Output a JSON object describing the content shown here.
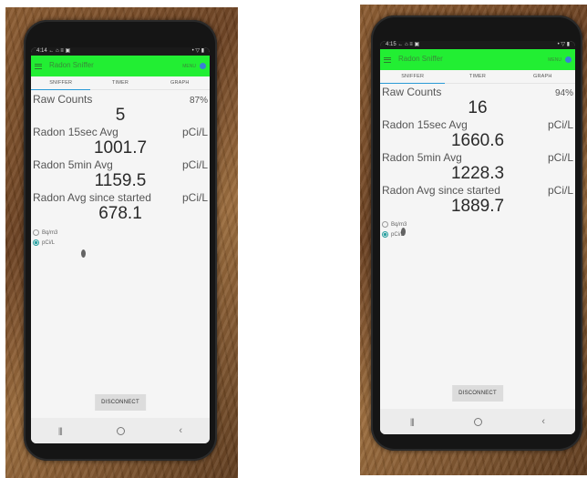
{
  "screenshots": [
    {
      "status_left": "4:14 ← ⌂ ≡ ▣",
      "status_right": "• ▽ ▮",
      "app_title": "Radon Sniffer",
      "app_subtitle": "",
      "menu_label": "MENU",
      "tabs": [
        "SNIFFER",
        "TIMER",
        "GRAPH"
      ],
      "raw_counts_label": "Raw Counts",
      "battery": "87%",
      "raw_counts": "5",
      "avg15_label": "Radon 15sec Avg",
      "avg15_unit": "pCi/L",
      "avg15_value": "1001.7",
      "avg5_label": "Radon 5min Avg",
      "avg5_unit": "pCi/L",
      "avg5_value": "1159.5",
      "avg_all_label": "Radon Avg since started",
      "avg_all_unit": "pCi/L",
      "avg_all_value": "678.1",
      "radio_options": [
        "Bq/m3",
        "pCi/L"
      ],
      "selected_unit": "pCi/L",
      "disconnect_label": "DISCONNECT",
      "nav_recents": "|||",
      "nav_back": "‹"
    },
    {
      "status_left": "4:15 ← ⌂ ≡ ▣",
      "status_right": "• ▽ ▮",
      "app_title": "Radon Sniffer",
      "app_subtitle": "",
      "menu_label": "MENU",
      "tabs": [
        "SNIFFER",
        "TIMER",
        "GRAPH"
      ],
      "raw_counts_label": "Raw Counts",
      "battery": "94%",
      "raw_counts": "16",
      "avg15_label": "Radon 15sec Avg",
      "avg15_unit": "pCi/L",
      "avg15_value": "1660.6",
      "avg5_label": "Radon 5min Avg",
      "avg5_unit": "pCi/L",
      "avg5_value": "1228.3",
      "avg_all_label": "Radon Avg since started",
      "avg_all_unit": "pCi/L",
      "avg_all_value": "1889.7",
      "radio_options": [
        "Bq/m3",
        "pCi/L"
      ],
      "selected_unit": "pCi/L",
      "disconnect_label": "DISCONNECT",
      "nav_recents": "|||",
      "nav_back": "‹"
    }
  ],
  "colors": {
    "app_bar": "#22ee33",
    "tab_indicator": "#2a9ad6",
    "bluetooth_dot": "#3a7fd6",
    "radio_selected": "#2aa0a0",
    "table_wood": "#8a5a2e"
  }
}
